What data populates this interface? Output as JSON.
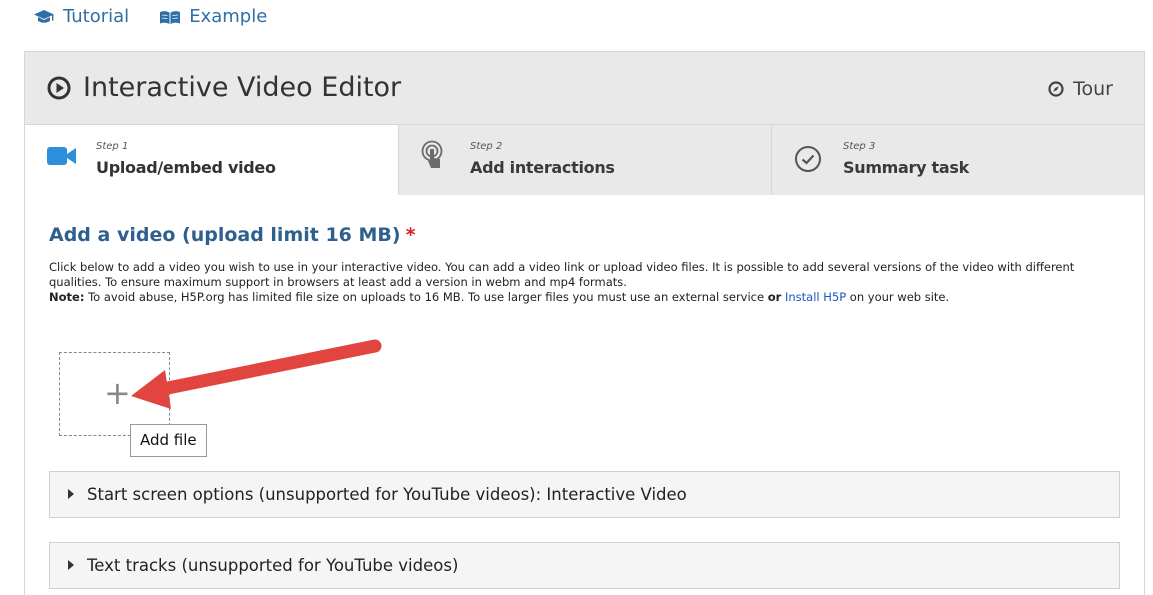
{
  "top_links": [
    {
      "label": "Tutorial",
      "icon": "graduation-cap-icon"
    },
    {
      "label": "Example",
      "icon": "open-book-icon"
    }
  ],
  "editor": {
    "title": "Interactive Video Editor",
    "tour_label": "Tour"
  },
  "steps": [
    {
      "number": "Step 1",
      "label": "Upload/embed video",
      "icon": "video-camera-icon",
      "active": true
    },
    {
      "number": "Step 2",
      "label": "Add interactions",
      "icon": "touch-pointer-icon",
      "active": false
    },
    {
      "number": "Step 3",
      "label": "Summary task",
      "icon": "check-circle-icon",
      "active": false
    }
  ],
  "video_field": {
    "title": "Add a video (upload limit 16 MB)",
    "required_mark": "*",
    "description_1": "Click below to add a video you wish to use in your interactive video. You can add a video link or upload video files. It is possible to add several versions of the video with different qualities. To ensure maximum support in browsers at least add a version in webm and mp4 formats.",
    "note_label": "Note:",
    "note_text_1": " To avoid abuse, H5P.org has limited file size on uploads to 16 MB. To use larger files you must use an external service ",
    "note_or": "or",
    "note_link": "Install H5P",
    "note_text_2": " on your web site.",
    "add_symbol": "+",
    "add_tooltip": "Add file"
  },
  "sections": [
    {
      "label": "Start screen options (unsupported for YouTube videos): Interactive Video"
    },
    {
      "label": "Text tracks (unsupported for YouTube videos)"
    }
  ],
  "colors": {
    "link_blue": "#2f6fa7",
    "title_blue": "#2e5f8f",
    "video_icon_blue": "#2b8fdc",
    "arrow_red": "#e2453f",
    "required_red": "#d22222"
  }
}
